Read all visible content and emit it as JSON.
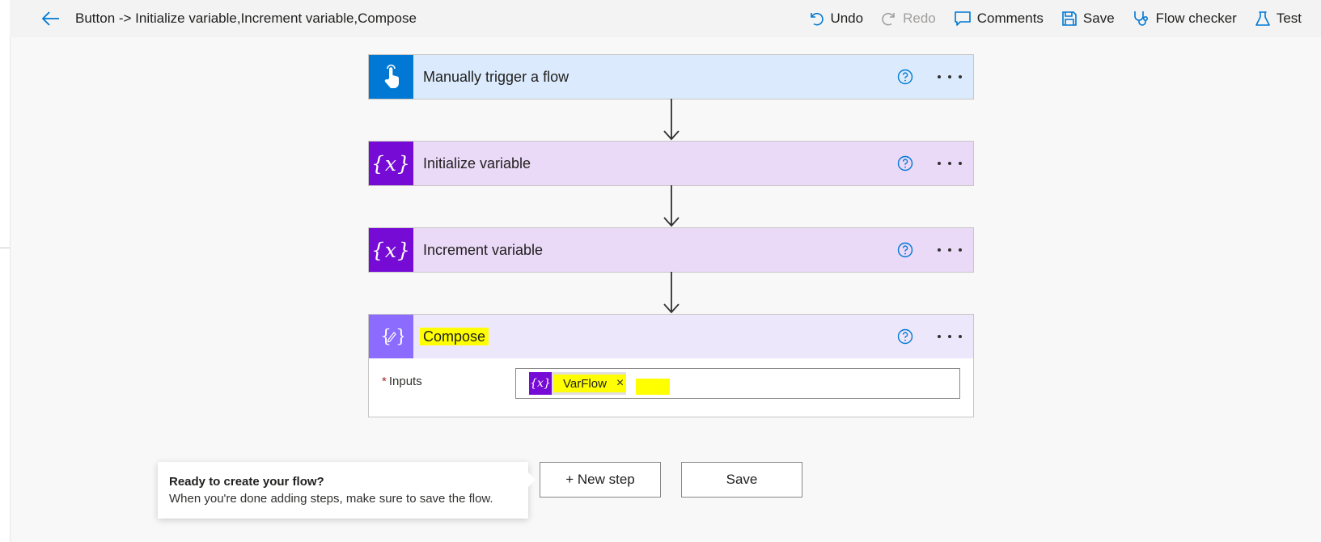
{
  "header": {
    "title": "Button -> Initialize variable,Increment variable,Compose",
    "toolbar": {
      "undo": "Undo",
      "redo": "Redo",
      "comments": "Comments",
      "save": "Save",
      "flow_checker": "Flow checker",
      "test": "Test"
    }
  },
  "steps": [
    {
      "title": "Manually trigger a flow",
      "icon": "touch-icon",
      "accent": "#0078d4",
      "background": "#dbebfd"
    },
    {
      "title": "Initialize variable",
      "icon": "variable-icon",
      "glyph": "{x}",
      "accent": "#770bd6",
      "background": "#ead9f7"
    },
    {
      "title": "Increment variable",
      "icon": "variable-icon",
      "glyph": "{x}",
      "accent": "#770bd6",
      "background": "#ead9f7"
    },
    {
      "title": "Compose",
      "icon": "compose-icon",
      "accent": "#8c6cff",
      "background": "#ede7fc",
      "inputs_label": "Inputs",
      "required_mark": "*",
      "token": {
        "glyph": "{x}",
        "label": "VarFlow",
        "remove": "×"
      }
    }
  ],
  "tip": {
    "title": "Ready to create your flow?",
    "text": "When you're done adding steps, make sure to save the flow."
  },
  "buttons": {
    "new_step": "+ New step",
    "save": "Save"
  },
  "colors": {
    "highlight": "#ffff00",
    "link_blue": "#0078d4"
  }
}
